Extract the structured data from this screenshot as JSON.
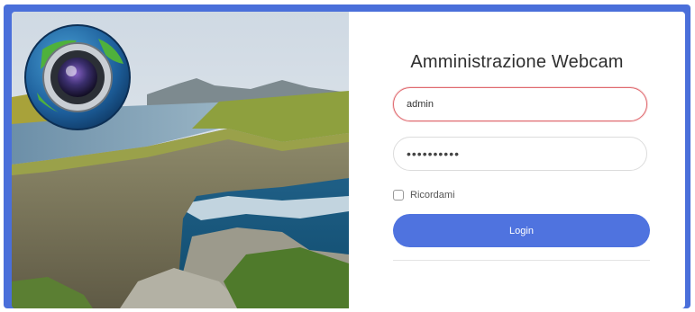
{
  "login_form": {
    "title": "Amministrazione Webcam",
    "username_value": "admin",
    "password_mask": "••••••••••",
    "remember_label": "Ricordami",
    "remember_checked": false,
    "login_label": "Login"
  },
  "colors": {
    "frame": "#4a6fda",
    "login_button": "#4f73df",
    "username_focus_border": "#e06a70"
  },
  "icons": {
    "logo": "webcam-globe-lens-icon"
  }
}
